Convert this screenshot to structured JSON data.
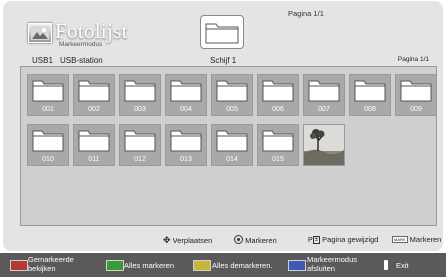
{
  "header": {
    "title": "Fotolijst",
    "subtitle": "Markeermodus",
    "page_indicator": "Pagina 1/1",
    "usb1": "USB1",
    "usb_station": "USB-station",
    "folder_name": "Schijf 1",
    "page_right": "Pagina 1/1"
  },
  "tiles": [
    {
      "label": "001"
    },
    {
      "label": "002"
    },
    {
      "label": "003"
    },
    {
      "label": "004"
    },
    {
      "label": "005"
    },
    {
      "label": "006"
    },
    {
      "label": "007"
    },
    {
      "label": "008"
    },
    {
      "label": "009"
    },
    {
      "label": "010"
    },
    {
      "label": "011"
    },
    {
      "label": "012"
    },
    {
      "label": "013"
    },
    {
      "label": "014"
    },
    {
      "label": "015"
    }
  ],
  "legend": {
    "move": "Verplaatsen",
    "mark": "Markeren",
    "page_change": "Pagina gewijzigd",
    "mark_key": "MARK",
    "mark_label": "Markeren"
  },
  "footer": {
    "red_label": "Gemarkeerde bekijken",
    "green_label": "Alles markeren",
    "yellow_label": "Alles demarkeren.",
    "blue_label": "Markeermodus afsluiten",
    "exit_label": "Exit"
  },
  "colors": {
    "red": "#b43a3a",
    "green": "#3a9a3a",
    "yellow": "#c8b43a",
    "blue": "#3a5ab4"
  }
}
